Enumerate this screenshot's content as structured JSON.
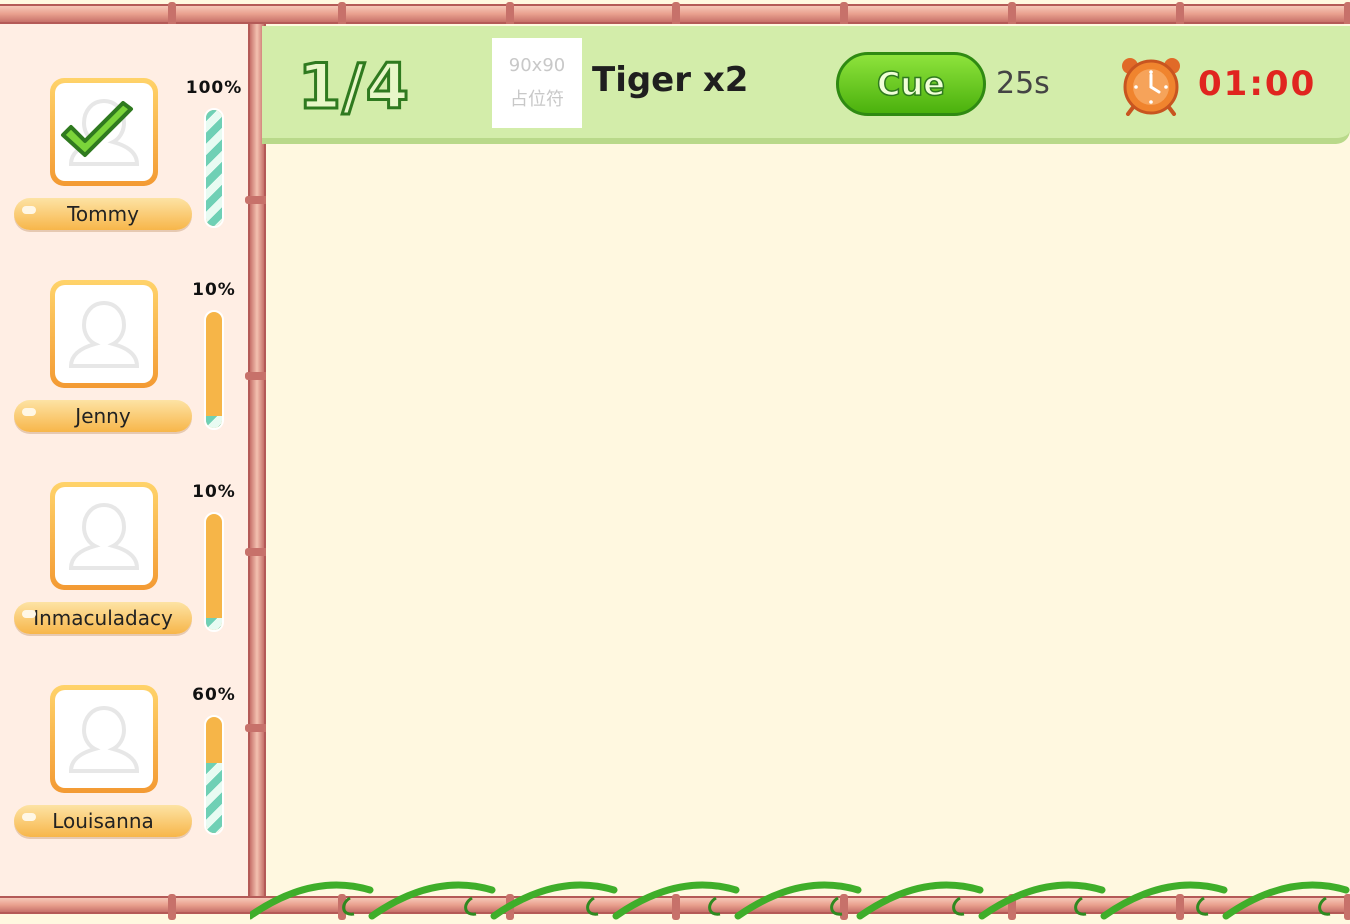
{
  "header": {
    "round_label": "1/4",
    "placeholder_line1": "90x90",
    "placeholder_line2": "占位符",
    "target_word": "Tiger x2",
    "cue_label": "Cue",
    "cue_time": "25s",
    "timer": "01:00",
    "colors": {
      "timer": "#e0251f",
      "cue": "#4bb10d",
      "header_bg": "#d3edaa"
    },
    "icons": {
      "clock": "alarm-clock-icon"
    }
  },
  "players": [
    {
      "name": "Tommy",
      "percent_label": "100%",
      "progress": 1.0,
      "completed": true
    },
    {
      "name": "Jenny",
      "percent_label": "10%",
      "progress": 0.1,
      "completed": false
    },
    {
      "name": "Inmaculadacy",
      "percent_label": "10%",
      "progress": 0.1,
      "completed": false
    },
    {
      "name": "Louisanna",
      "percent_label": "60%",
      "progress": 0.6,
      "completed": false
    }
  ]
}
